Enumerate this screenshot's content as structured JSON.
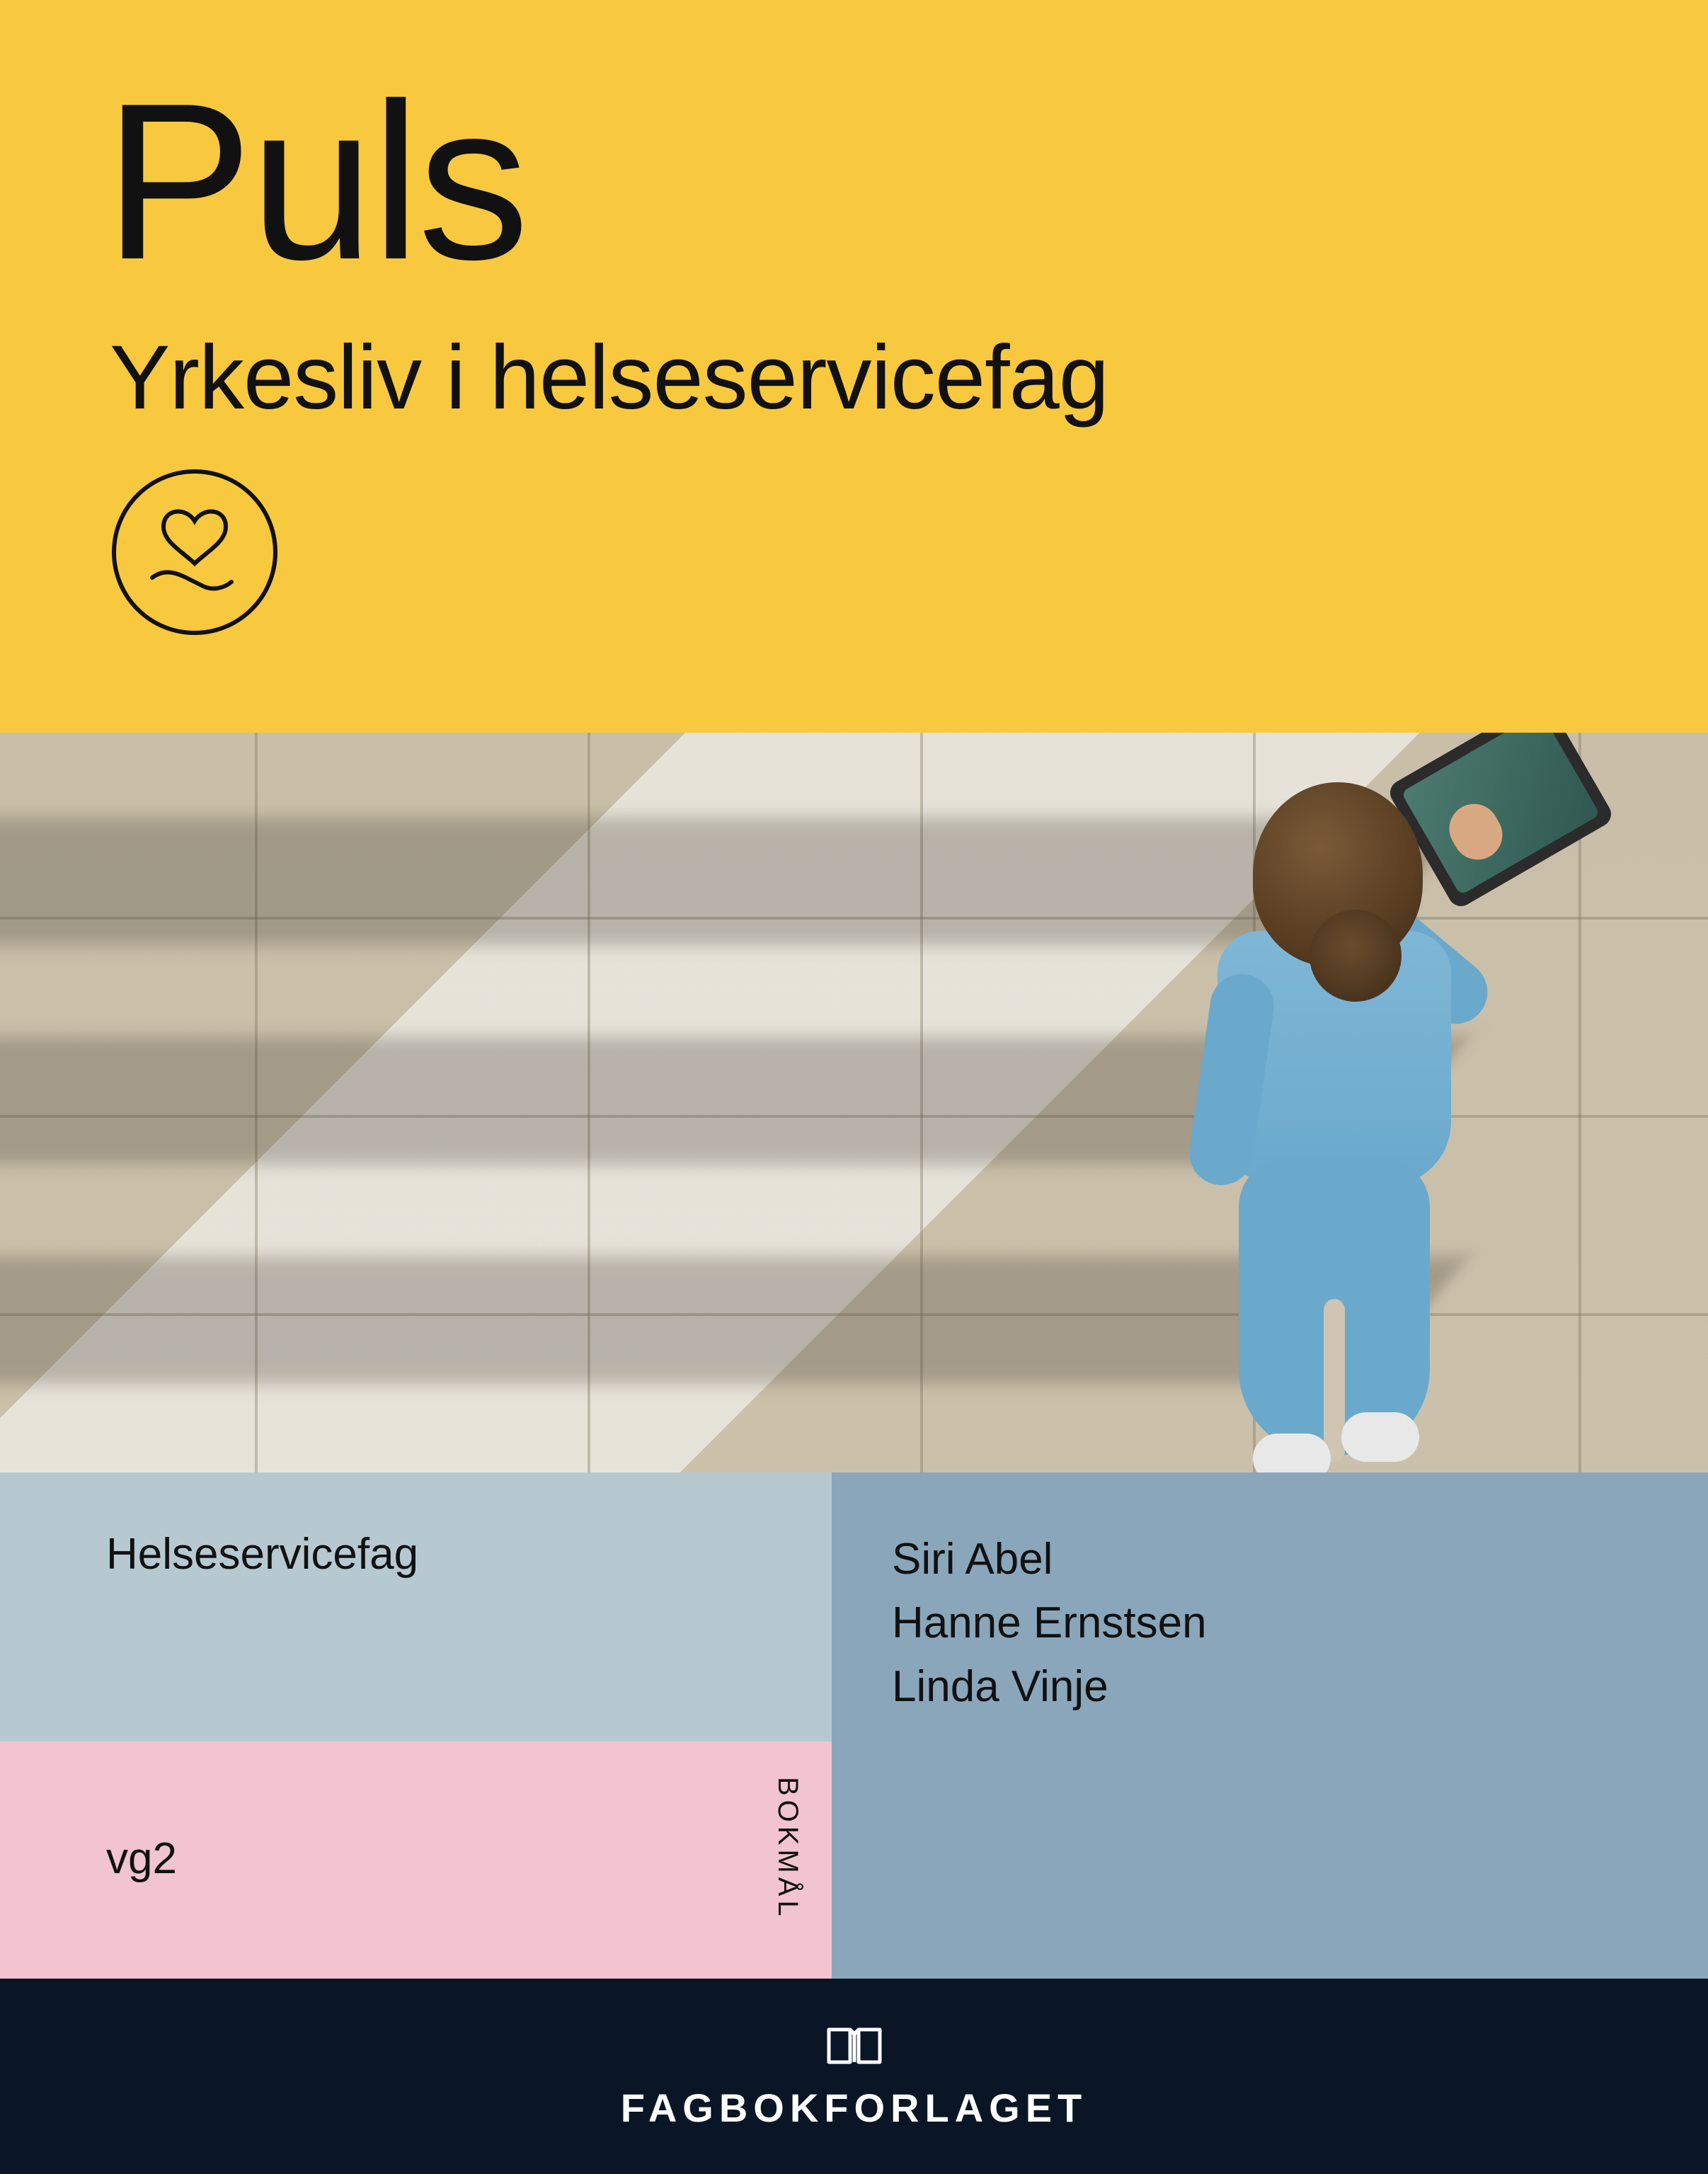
{
  "title": "Puls",
  "subtitle": "Yrkesliv i helseservicefag",
  "subject": "Helseservicefag",
  "level": "vg2",
  "language": "BOKMÅL",
  "authors": [
    "Siri Abel",
    "Hanne Ernstsen",
    "Linda Vinje"
  ],
  "publisher": "FAGBOKFORLAGET",
  "colors": {
    "yellow": "#f8c93e",
    "lightBlue": "#b7c9d0",
    "pink": "#f1c4cf",
    "slateBlue": "#8aa6bb",
    "navy": "#0a1626"
  }
}
